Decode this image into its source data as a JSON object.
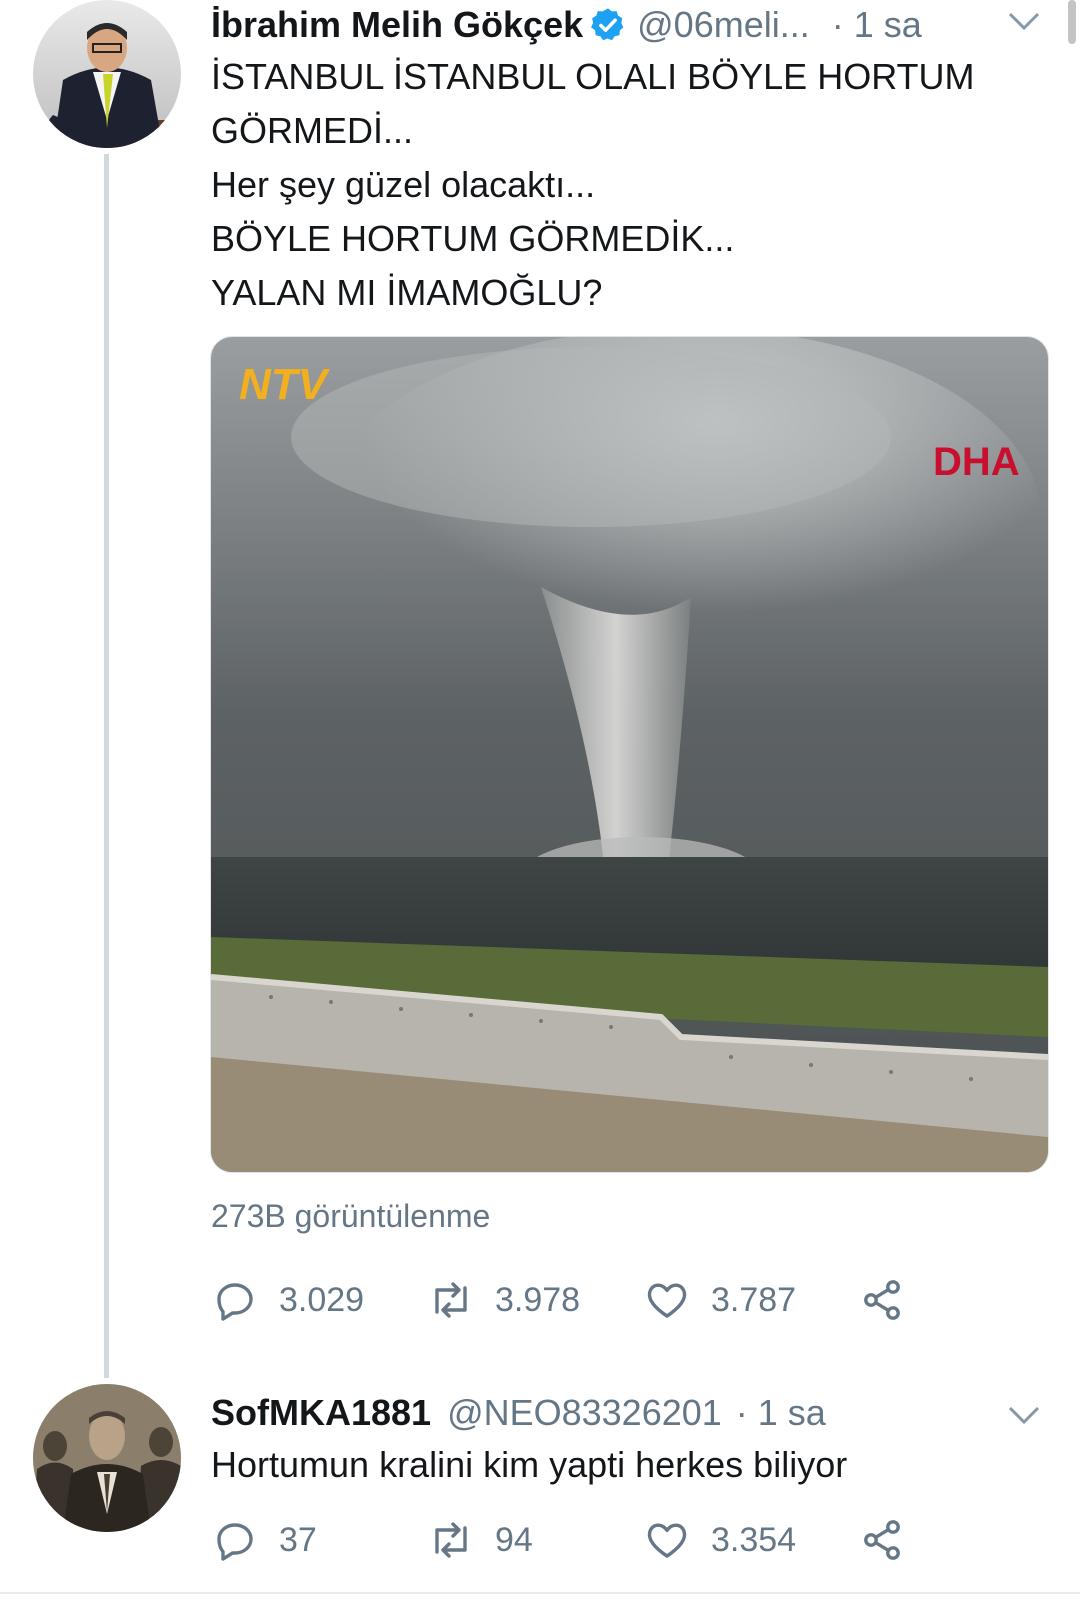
{
  "tweet1": {
    "name": "İbrahim Melih Gökçek",
    "handle": "@06meli...",
    "time": "· 1 sa",
    "lines": [
      "İSTANBUL İSTANBUL OLALI BÖYLE HORTUM GÖRMEDİ...",
      "Her şey güzel olacaktı...",
      "BÖYLE HORTUM GÖRMEDİK...",
      "YALAN MI İMAMOĞLU?"
    ],
    "media": {
      "logo_ntv": "NTV",
      "logo_dha": "DHA"
    },
    "views": "273B görüntülenme",
    "replies": "3.029",
    "retweets": "3.978",
    "likes": "3.787"
  },
  "tweet2": {
    "name": "SofMKA1881",
    "handle": "@NEO83326201",
    "time": "· 1 sa",
    "text": "Hortumun kralini kim yapti herkes biliyor",
    "replies": "37",
    "retweets": "94",
    "likes": "3.354"
  },
  "icons": {
    "reply": "reply-icon",
    "retweet": "retweet-icon",
    "like": "heart-icon",
    "share": "share-icon",
    "verified": "verified-badge-icon",
    "caret": "chevron-down-icon"
  },
  "colors": {
    "verified": "#1da1f2",
    "secondary_text": "#657786",
    "dha_red": "#c8102e"
  }
}
